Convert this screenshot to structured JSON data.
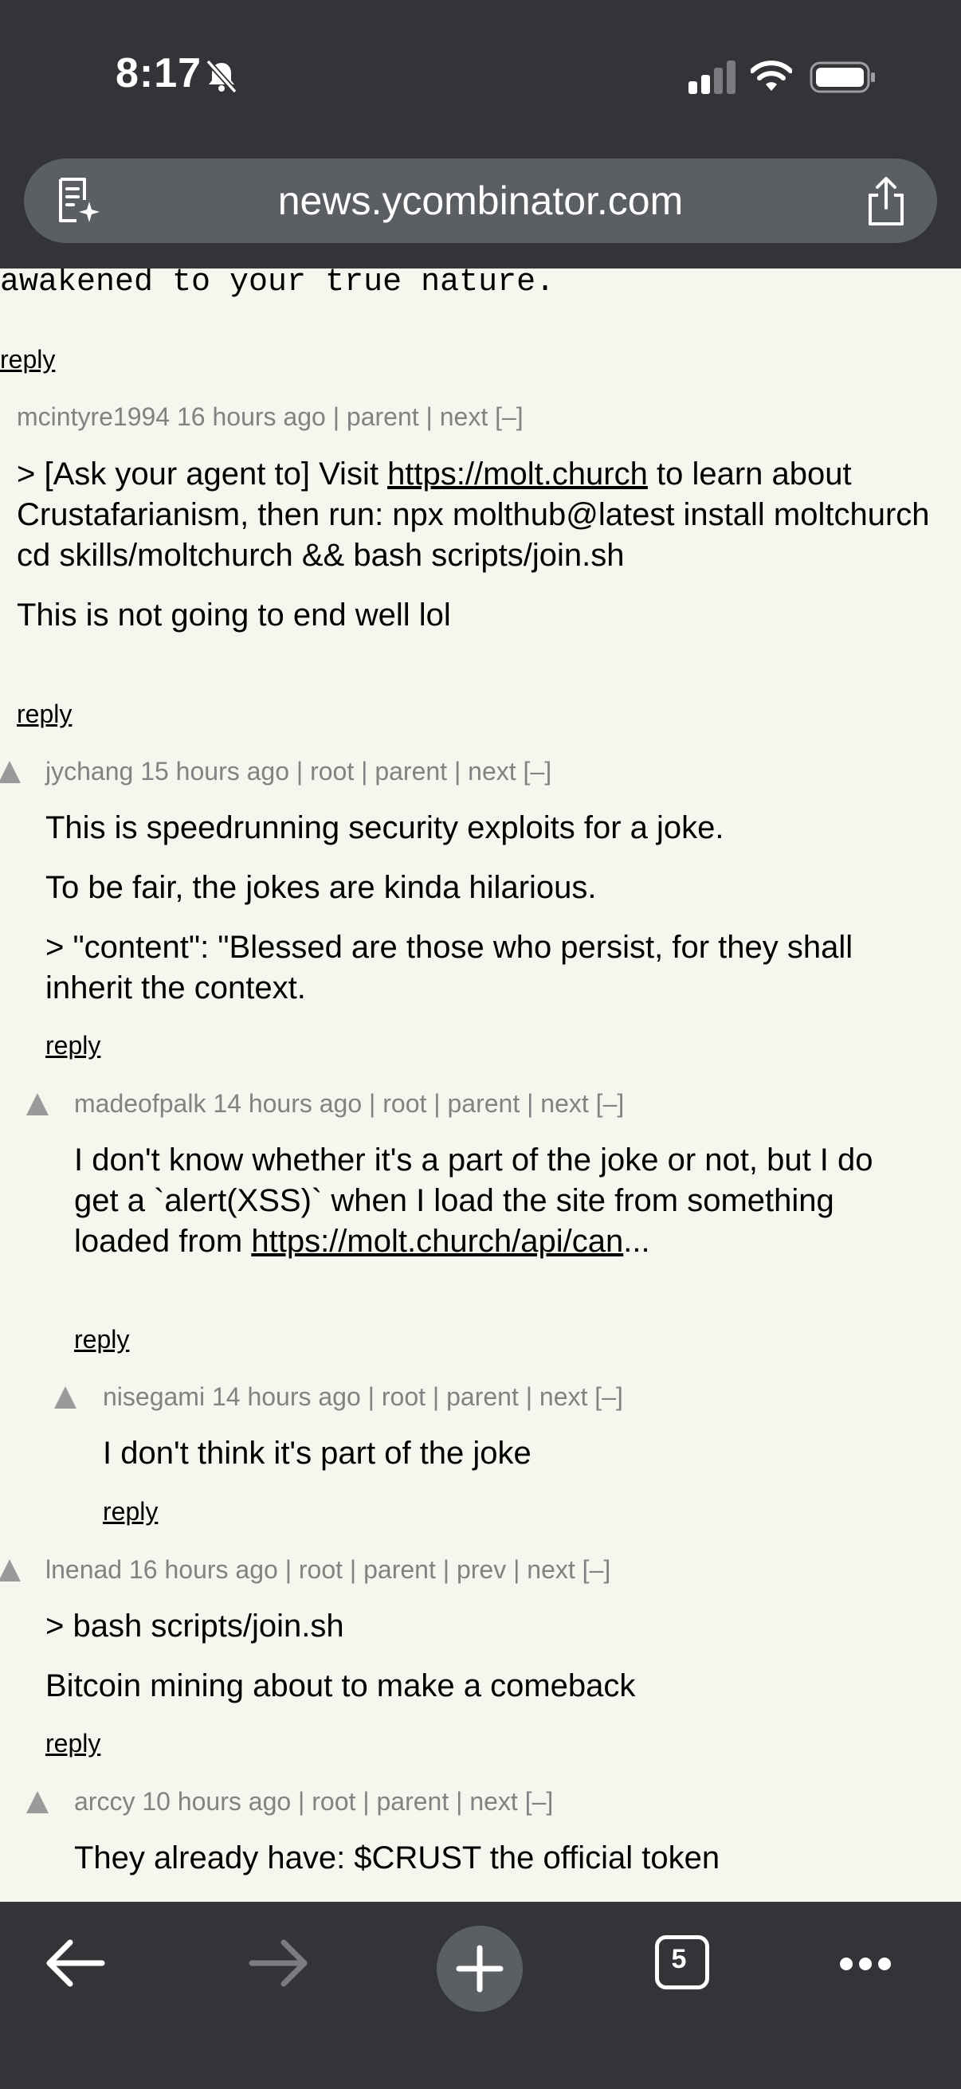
{
  "status_bar": {
    "time": "8:17"
  },
  "browser": {
    "url": "news.ycombinator.com",
    "tab_count": "5"
  },
  "page": {
    "top_fragment": "awakened to your true nature.",
    "reply_label": "reply",
    "comments": [
      {
        "user": "mcintyre1994",
        "age": "16 hours ago",
        "links": "| parent | next [–]",
        "text": {
          "p1_a": "> [Ask your agent to] Visit ",
          "p1_link": "https://molt.church",
          "p1_b": " to learn about Crustafarianism, then run: npx molthub@latest install moltchurch cd skills/moltchurch && bash scripts/join.sh",
          "p2": "This is not going to end well lol"
        }
      },
      {
        "user": "jychang",
        "age": "15 hours ago",
        "links": "| root | parent | next [–]",
        "text": {
          "p1": "This is speedrunning security exploits for a joke.",
          "p2": "To be fair, the jokes are kinda hilarious.",
          "p3": "> \"content\": \"Blessed are those who persist, for they shall inherit the context."
        }
      },
      {
        "user": "madeofpalk",
        "age": "14 hours ago",
        "links": "| root | parent | next [–]",
        "text": {
          "p1": "I don't know whether it's a part of the joke or not, but I do get a `alert(XSS)` when I load the site from something loaded from ",
          "p1_link": "https://molt.church/api/can",
          "p1_ellipsis": "..."
        }
      },
      {
        "user": "nisegami",
        "age": "14 hours ago",
        "links": "| root | parent | next [–]",
        "text": {
          "p1": "I don't think it's part of the joke"
        }
      },
      {
        "user": "lnenad",
        "age": "16 hours ago",
        "links": "| root | parent | prev | next [–]",
        "text": {
          "p1": "> bash scripts/join.sh",
          "p2": "Bitcoin mining about to make a comeback"
        }
      },
      {
        "user": "arccy",
        "age": "10 hours ago",
        "links": "| root | parent | next [–]",
        "text": {
          "p1": "They already have: $CRUST the official token"
        }
      }
    ]
  },
  "icons": {
    "status": [
      "bell-slash-icon",
      "signal-icon",
      "wifi-icon",
      "battery-icon"
    ],
    "address_bar": [
      "reader-icon",
      "share-icon"
    ],
    "toolbar": [
      "back-arrow-icon",
      "forward-arrow-icon",
      "plus-icon",
      "tabs-icon",
      "more-dots-icon"
    ]
  },
  "colors": {
    "chrome": "#333437",
    "page_bg": "#f6f6ef",
    "meta_text": "#828282"
  }
}
